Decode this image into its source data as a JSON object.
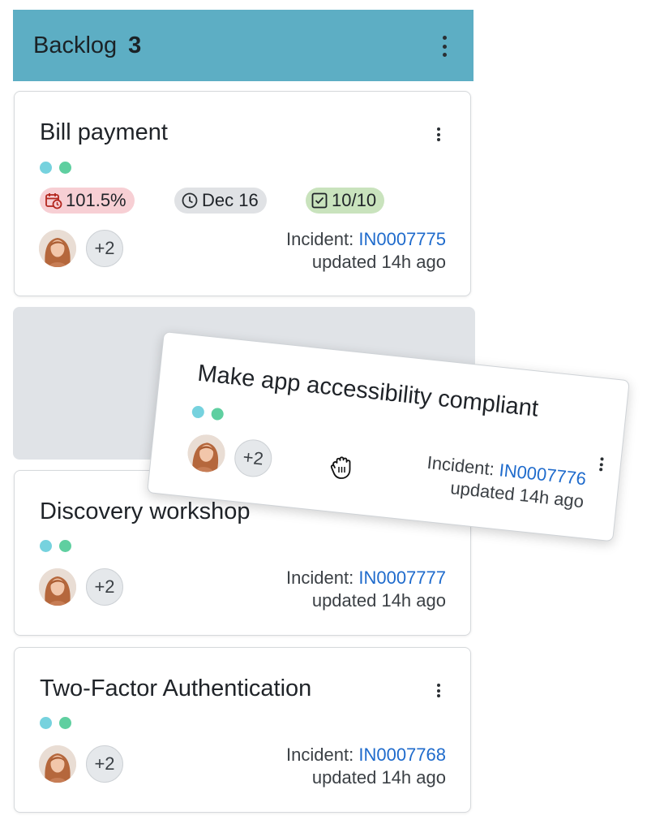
{
  "column": {
    "title": "Backlog",
    "count": "3"
  },
  "colors": {
    "header_bg": "#5daec4",
    "dot_teal": "#76d2de",
    "dot_green": "#5fcfa0",
    "link": "#1f6bcc",
    "badge_overdue_bg": "#f7cfd4",
    "badge_date_bg": "#e0e2e5",
    "badge_tasks_bg": "#c9e3bd"
  },
  "cards": [
    {
      "title": "Bill payment",
      "badges": {
        "progress": "101.5%",
        "progress_icon": "calendar-clock-icon",
        "due": "Dec 16",
        "due_icon": "clock-icon",
        "tasks": "10/10",
        "tasks_icon": "checkbox-icon"
      },
      "more_users": "+2",
      "incident_label": "Incident:",
      "incident_id": "IN0007775",
      "updated": "updated 14h ago"
    },
    {
      "title": "Make app accessibility compliant",
      "more_users": "+2",
      "incident_label": "Incident:",
      "incident_id": "IN0007776",
      "updated": "updated 14h ago"
    },
    {
      "title": "Discovery workshop",
      "more_users": "+2",
      "incident_label": "Incident:",
      "incident_id": "IN0007777",
      "updated": "updated 14h ago"
    },
    {
      "title": "Two-Factor Authentication",
      "more_users": "+2",
      "incident_label": "Incident:",
      "incident_id": "IN0007768",
      "updated": "updated 14h ago"
    }
  ]
}
